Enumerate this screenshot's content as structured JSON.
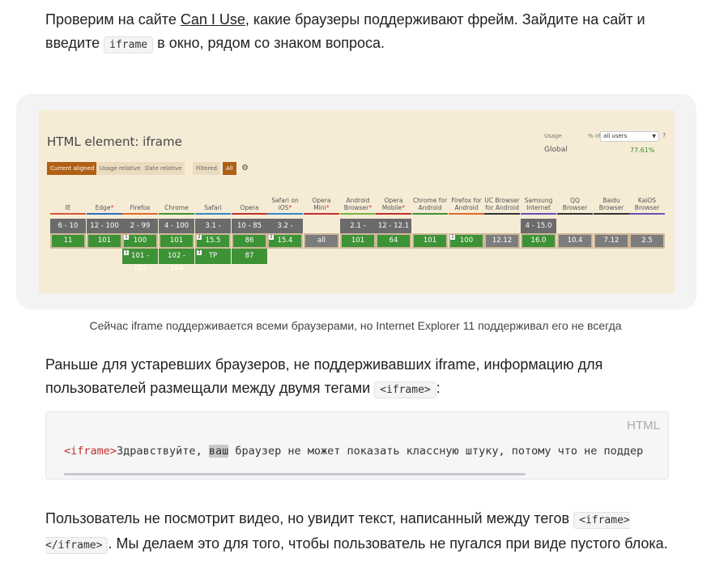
{
  "para1": {
    "text_before": "Проверим на сайте ",
    "link": "Can I Use",
    "text_middle": ", какие браузеры поддерживают фрейм. Зайдите на сайт и введите ",
    "code": "iframe",
    "text_after": " в окно, рядом со знаком вопроса."
  },
  "ciu": {
    "title": "HTML element: iframe",
    "usage_label": "Usage",
    "usage_of": "% of",
    "usage_select": "all users",
    "help": "?",
    "global_label": "Global",
    "global_value": "77.61%",
    "toolbar": [
      "Current aligned",
      "Usage relative",
      "Date relative",
      "Filtered",
      "All"
    ],
    "gear": "⚙",
    "browsers": [
      {
        "name": "IE",
        "asterisk": "",
        "bar": "#d35a3a",
        "cells": [
          [
            "6 - 10",
            "red"
          ],
          [
            "11",
            "green"
          ]
        ]
      },
      {
        "name": "Edge",
        "asterisk": "*",
        "bar": "#2f6fbf",
        "cells": [
          [
            "12 - 100",
            "red"
          ],
          [
            "101",
            "green"
          ]
        ]
      },
      {
        "name": "Firefox",
        "asterisk": "",
        "bar": "#e06a2a",
        "cells": [
          [
            "2 - 99",
            "red"
          ],
          [
            "100",
            "green",
            "1"
          ],
          [
            "101 - 102",
            "green",
            "1"
          ]
        ]
      },
      {
        "name": "Chrome",
        "asterisk": "",
        "bar": "#3e9236",
        "cells": [
          [
            "4 - 100",
            "red"
          ],
          [
            "101",
            "green"
          ],
          [
            "102 - 104",
            "green"
          ]
        ]
      },
      {
        "name": "Safari",
        "asterisk": "",
        "bar": "#3a87c8",
        "cells": [
          [
            "3.1 - 15.4",
            "red"
          ],
          [
            "15.5",
            "green",
            "2"
          ],
          [
            "TP",
            "green",
            "2"
          ]
        ]
      },
      {
        "name": "Opera",
        "asterisk": "",
        "bar": "#c4302b",
        "cells": [
          [
            "10 - 85",
            "red"
          ],
          [
            "86",
            "green"
          ],
          [
            "87",
            "green"
          ]
        ]
      },
      {
        "name": "Safari on iOS",
        "asterisk": "*",
        "bar": "#3a87c8",
        "cells": [
          [
            "3.2 - 15.3",
            "red"
          ],
          [
            "15.4",
            "green",
            "2"
          ]
        ]
      },
      {
        "name": "Opera Mini",
        "asterisk": "*",
        "bar": "#c4302b",
        "cells": [
          [
            "",
            "none"
          ],
          [
            "all",
            "grey"
          ]
        ]
      },
      {
        "name": "Android Browser",
        "asterisk": "*",
        "bar": "#7cb342",
        "cells": [
          [
            "2.1 - 4.4.4",
            "red"
          ],
          [
            "101",
            "green"
          ]
        ]
      },
      {
        "name": "Opera Mobile",
        "asterisk": "*",
        "bar": "#c4302b",
        "cells": [
          [
            "12 - 12.1",
            "red"
          ],
          [
            "64",
            "green"
          ]
        ]
      },
      {
        "name": "Chrome for Android",
        "asterisk": "",
        "bar": "#3e9236",
        "cells": [
          [
            "",
            "none"
          ],
          [
            "101",
            "green"
          ]
        ]
      },
      {
        "name": "Firefox for Android",
        "asterisk": "",
        "bar": "#e06a2a",
        "cells": [
          [
            "",
            "none"
          ],
          [
            "100",
            "green",
            "1"
          ]
        ]
      },
      {
        "name": "UC Browser for Android",
        "asterisk": "",
        "bar": "#333333",
        "cells": [
          [
            "",
            "none"
          ],
          [
            "12.12",
            "grey"
          ]
        ]
      },
      {
        "name": "Samsung Internet",
        "asterisk": "",
        "bar": "#6a4fb6",
        "cells": [
          [
            "4 - 15.0",
            "red"
          ],
          [
            "16.0",
            "green"
          ]
        ]
      },
      {
        "name": "QQ Browser",
        "asterisk": "",
        "bar": "#333333",
        "cells": [
          [
            "",
            "none"
          ],
          [
            "10.4",
            "grey"
          ]
        ]
      },
      {
        "name": "Baidu Browser",
        "asterisk": "",
        "bar": "#333333",
        "cells": [
          [
            "",
            "none"
          ],
          [
            "7.12",
            "grey"
          ]
        ]
      },
      {
        "name": "KaiOS Browser",
        "asterisk": "",
        "bar": "#6a4fb6",
        "cells": [
          [
            "",
            "none"
          ],
          [
            "2.5",
            "grey"
          ]
        ]
      }
    ]
  },
  "caption": "Сейчас iframe поддерживается всеми браузерами, но Internet Explorer 11 поддерживал его не всегда",
  "para2": {
    "text": "Раньше для устаревших браузеров, не поддерживавших iframe, информацию для пользователей размещали между двумя тегами ",
    "code": "<iframe>",
    "after": ":"
  },
  "code_block": {
    "lang": "HTML",
    "tag": "<iframe>",
    "text_a": "Здравствуйте, ",
    "text_sel": "ваш",
    "text_b": " браузер не может показать классную штуку, потому что не поддер"
  },
  "para3": {
    "text": "Пользователь не посмотрит видео, но увидит текст, написанный между тегов ",
    "code": "<iframe></iframe>",
    "after": ". Мы делаем это для того, чтобы пользователь не пугался при виде пустого блока."
  }
}
